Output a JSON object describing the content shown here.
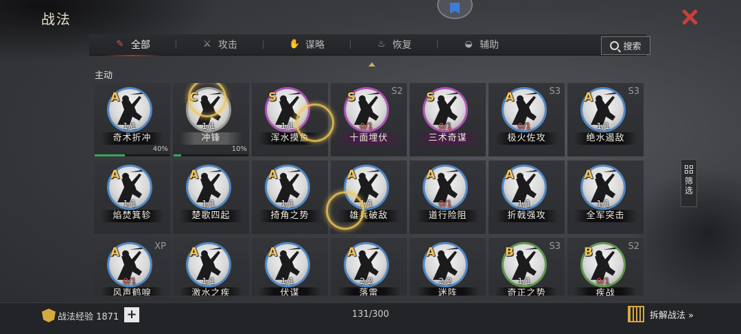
{
  "header": {
    "title": "战法"
  },
  "tabs": [
    {
      "label": "全部",
      "icon": "scroll-icon",
      "active": true
    },
    {
      "label": "攻击",
      "icon": "crossed-swords-icon",
      "active": false
    },
    {
      "label": "谋略",
      "icon": "hand-icon",
      "active": false
    },
    {
      "label": "恢复",
      "icon": "cauldron-icon",
      "active": false
    },
    {
      "label": "辅助",
      "icon": "pouch-icon",
      "active": false
    }
  ],
  "search": {
    "label": "搜索"
  },
  "section": {
    "label": "主动"
  },
  "cards": [
    {
      "grade": "A",
      "rarity": "a",
      "tag": "",
      "count": "1/1",
      "count_red": false,
      "name": "奇术折冲",
      "name_style": "",
      "progress_label": "40%",
      "progress": 0.4
    },
    {
      "grade": "C",
      "rarity": "c",
      "tag": "",
      "count": "1/1",
      "count_red": false,
      "name": "冲锋",
      "name_style": "hl",
      "progress_label": "10%",
      "progress": 0.1
    },
    {
      "grade": "S",
      "rarity": "s",
      "tag": "",
      "count": "1/1",
      "count_red": false,
      "name": "浑水摸鱼",
      "name_style": ""
    },
    {
      "grade": "S",
      "rarity": "s",
      "tag": "S2",
      "count": "0/1",
      "count_red": true,
      "name": "十面埋伏",
      "name_style": "purple"
    },
    {
      "grade": "S",
      "rarity": "s",
      "tag": "",
      "count": "0/1",
      "count_red": true,
      "name": "三术奇谋",
      "name_style": "purple"
    },
    {
      "grade": "A",
      "rarity": "a",
      "tag": "S3",
      "count": "0/1",
      "count_red": true,
      "name": "极火佐攻",
      "name_style": ""
    },
    {
      "grade": "A",
      "rarity": "a",
      "tag": "S3",
      "count": "1/1",
      "count_red": false,
      "name": "绝水遏敌",
      "name_style": ""
    },
    {
      "grade": "A",
      "rarity": "a",
      "tag": "",
      "count": "1/1",
      "count_red": false,
      "name": "焰焚箕轸",
      "name_style": ""
    },
    {
      "grade": "A",
      "rarity": "a",
      "tag": "",
      "count": "1/1",
      "count_red": false,
      "name": "楚歌四起",
      "name_style": ""
    },
    {
      "grade": "A",
      "rarity": "a",
      "tag": "",
      "count": "1/1",
      "count_red": false,
      "name": "掎角之势",
      "name_style": ""
    },
    {
      "grade": "A",
      "rarity": "a",
      "tag": "",
      "count": "1/1",
      "count_red": false,
      "name": "雄兵破敌",
      "name_style": ""
    },
    {
      "grade": "A",
      "rarity": "a",
      "tag": "",
      "count": "0/1",
      "count_red": true,
      "name": "道行险阻",
      "name_style": ""
    },
    {
      "grade": "A",
      "rarity": "a",
      "tag": "",
      "count": "1/1",
      "count_red": false,
      "name": "折戟强攻",
      "name_style": ""
    },
    {
      "grade": "A",
      "rarity": "a",
      "tag": "",
      "count": "1/1",
      "count_red": false,
      "name": "全军突击",
      "name_style": ""
    },
    {
      "grade": "A",
      "rarity": "a",
      "tag": "XP",
      "count": "0/1",
      "count_red": true,
      "name": "风声鹤唳",
      "name_style": ""
    },
    {
      "grade": "A",
      "rarity": "a",
      "tag": "",
      "count": "1/1",
      "count_red": false,
      "name": "激水之疾",
      "name_style": ""
    },
    {
      "grade": "A",
      "rarity": "a",
      "tag": "",
      "count": "1/1",
      "count_red": false,
      "name": "伏谋",
      "name_style": ""
    },
    {
      "grade": "A",
      "rarity": "a",
      "tag": "",
      "count": "2/2",
      "count_red": false,
      "name": "落雷",
      "name_style": ""
    },
    {
      "grade": "A",
      "rarity": "a",
      "tag": "",
      "count": "2/2",
      "count_red": false,
      "name": "迷阵",
      "name_style": ""
    },
    {
      "grade": "B",
      "rarity": "b",
      "tag": "S3",
      "count": "1/1",
      "count_red": false,
      "name": "奇正之势",
      "name_style": ""
    },
    {
      "grade": "B",
      "rarity": "b",
      "tag": "S2",
      "count": "0/1",
      "count_red": true,
      "name": "疾战",
      "name_style": ""
    }
  ],
  "filter": {
    "label": "筛选"
  },
  "footer": {
    "xp_label": "战法经验 1871",
    "capacity": "131/300",
    "disassemble_label": "拆解战法 »"
  }
}
